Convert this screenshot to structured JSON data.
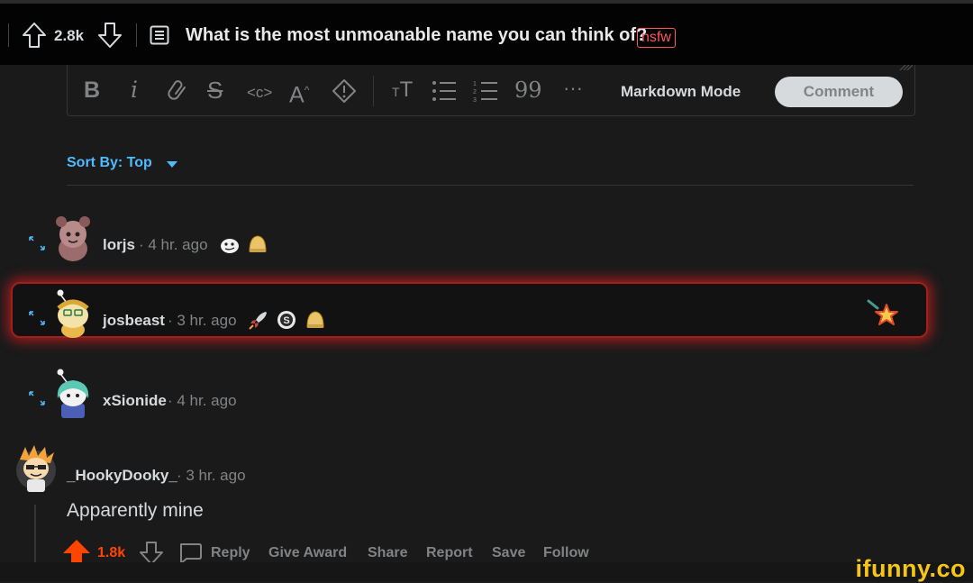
{
  "header": {
    "score": "2.8k",
    "title": "What is the most unmoanable name you can think of?",
    "nsfw_label": "nsfw"
  },
  "editor": {
    "markdown_mode_label": "Markdown Mode",
    "comment_button_label": "Comment",
    "toolbar_icons": [
      "bold-icon",
      "italic-icon",
      "link-icon",
      "strikethrough-icon",
      "inline-code-icon",
      "superscript-icon",
      "spoiler-icon",
      "heading-icon",
      "bulleted-list-icon",
      "numbered-list-icon",
      "quote-icon",
      "more-icon"
    ]
  },
  "sort": {
    "label": "Sort By: Top"
  },
  "comments": [
    {
      "username": "lorjs",
      "age": "· 4 hr. ago",
      "collapsed": true
    },
    {
      "username": "josbeast",
      "age": "· 3 hr. ago",
      "collapsed": true,
      "highlighted": true
    },
    {
      "username": "xSionide",
      "age": "· 4 hr. ago",
      "collapsed": true
    },
    {
      "username": "_HookyDooky_",
      "age": "· 3 hr. ago",
      "body": "Apparently mine",
      "upvotes": "1.8k",
      "actions": {
        "reply": "Reply",
        "give_award": "Give Award",
        "share": "Share",
        "report": "Report",
        "save": "Save",
        "follow": "Follow"
      }
    }
  ],
  "watermark": "ifunny.co",
  "colors": {
    "accent_blue": "#4fbcff",
    "upvote_orange": "#ff4500",
    "nsfw_red": "#ff585b",
    "highlight_red": "#d32f2f"
  }
}
